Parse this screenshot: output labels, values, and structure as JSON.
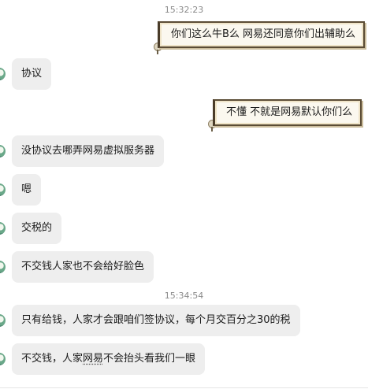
{
  "chat": {
    "timestamps": [
      "15:32:23",
      "15:34:54"
    ],
    "messages": [
      {
        "side": "out",
        "text": "你们这么牛B么 网易还同意你们出辅助么"
      },
      {
        "side": "in",
        "text": "协议"
      },
      {
        "side": "out",
        "text": "不懂  不就是网易默认你们么"
      },
      {
        "side": "in",
        "text": "没协议去哪弄网易虚拟服务器"
      },
      {
        "side": "in",
        "text": "嗯"
      },
      {
        "side": "in",
        "text": "交税的"
      },
      {
        "side": "in",
        "text": "不交钱人家也不会给好脸色"
      },
      {
        "side": "in",
        "text": "只有给钱，人家才会跟咱们签协议，每个月交百分之30的税"
      },
      {
        "side": "in",
        "text_before": "不交钱，人家",
        "text_marked": "网易",
        "text_after": "不会抬头看我们一眼"
      }
    ]
  },
  "icons": {
    "avatar": "contact-avatar-icon",
    "pin": "scroll-pin-icon"
  }
}
